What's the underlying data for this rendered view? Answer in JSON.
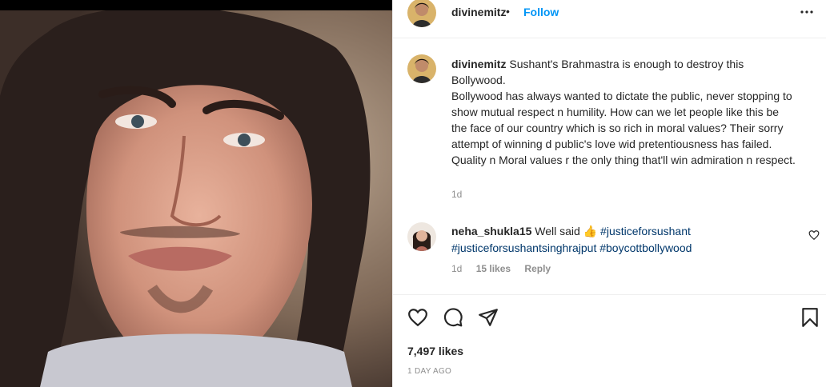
{
  "header": {
    "username": "divinemitz",
    "separator": "•",
    "follow_label": "Follow",
    "more_label": "•••"
  },
  "caption": {
    "username": "divinemitz",
    "text": "Sushant's Brahmastra is enough to destroy this Bollywood.",
    "body": "Bollywood has always wanted to dictate the public, never stopping to show mutual respect n humility. How can we let people like this be the face of our country which is so rich in moral values? Their sorry attempt of winning d public's love wid pretentiousness has failed. Quality n Moral values r the only thing that'll win admiration n respect.",
    "time": "1d"
  },
  "comment": {
    "username": "neha_shukla15",
    "text": "Well said",
    "emoji": "👍",
    "hashtags": [
      "#justiceforsushant",
      "#justiceforsushantsinghrajput",
      "#boycottbollywood"
    ],
    "time": "1d",
    "likes": "15 likes",
    "reply_label": "Reply"
  },
  "post": {
    "likes": "7,497 likes",
    "date": "1 DAY AGO"
  },
  "icons": {
    "like": "heart-icon",
    "comment": "comment-icon",
    "share": "share-icon",
    "save": "bookmark-icon",
    "more": "more-icon",
    "comment_like": "heart-icon"
  },
  "colors": {
    "follow": "#0095f6",
    "hashtag": "#00376b",
    "muted": "#8e8e8e",
    "text": "#262626"
  }
}
